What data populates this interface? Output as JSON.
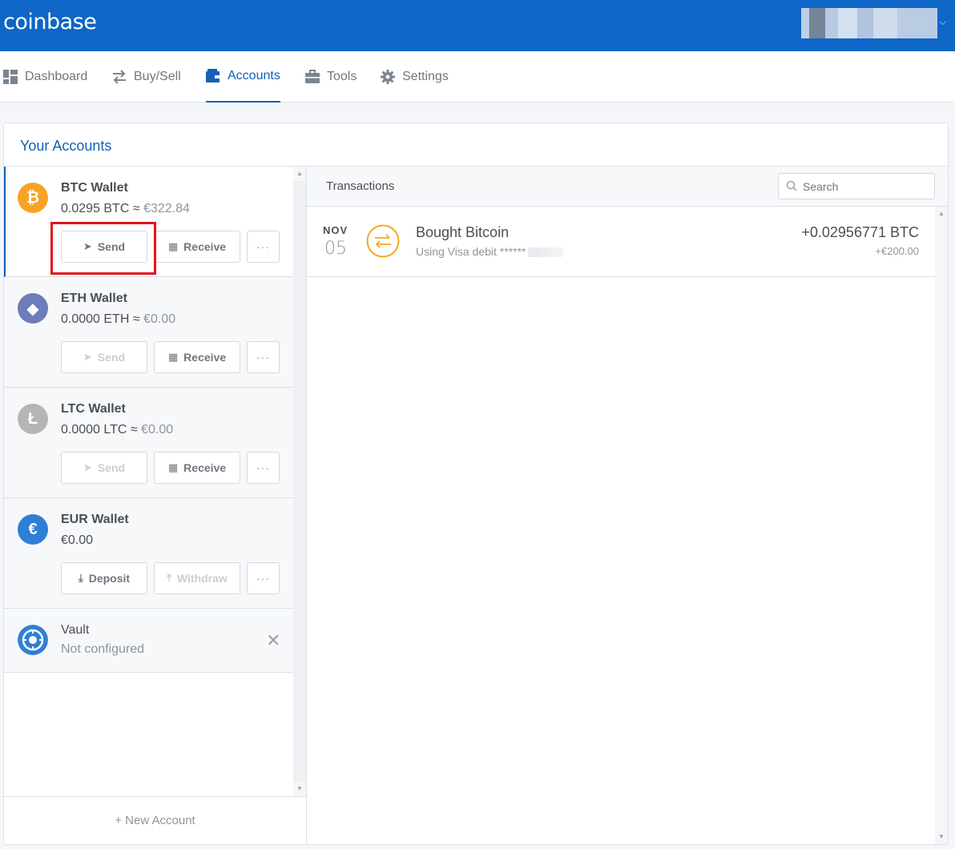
{
  "app": {
    "logo": "coinbase"
  },
  "nav": {
    "items": [
      {
        "label": "Dashboard",
        "icon": "dashboard-grid-icon"
      },
      {
        "label": "Buy/Sell",
        "icon": "swap-arrows-icon"
      },
      {
        "label": "Accounts",
        "icon": "wallet-icon",
        "active": true
      },
      {
        "label": "Tools",
        "icon": "briefcase-icon"
      },
      {
        "label": "Settings",
        "icon": "gear-icon"
      }
    ]
  },
  "accounts": {
    "title": "Your Accounts",
    "wallets": [
      {
        "name": "BTC Wallet",
        "balance": "0.0295 BTC ≈",
        "fiat": "€322.84",
        "color": "#f7a326",
        "symbol": "₿",
        "actions": [
          "Send",
          "Receive",
          "···"
        ],
        "disabled": [
          false,
          false,
          false
        ]
      },
      {
        "name": "ETH Wallet",
        "balance": "0.0000 ETH ≈",
        "fiat": "€0.00",
        "color": "#6f7cba",
        "symbol": "◆",
        "actions": [
          "Send",
          "Receive",
          "···"
        ],
        "disabled": [
          true,
          false,
          false
        ]
      },
      {
        "name": "LTC Wallet",
        "balance": "0.0000 LTC ≈",
        "fiat": "€0.00",
        "color": "#b5b5b5",
        "symbol": "Ł",
        "actions": [
          "Send",
          "Receive",
          "···"
        ],
        "disabled": [
          true,
          false,
          false
        ]
      },
      {
        "name": "EUR Wallet",
        "balance": "€0.00",
        "fiat": "",
        "color": "#2f7fd6",
        "symbol": "€",
        "actions": [
          "Deposit",
          "Withdraw",
          "···"
        ],
        "disabled": [
          false,
          true,
          false
        ]
      }
    ],
    "vault": {
      "name": "Vault",
      "status": "Not configured",
      "color": "#2f7fd6"
    },
    "new_account": "+ New Account"
  },
  "transactions": {
    "title": "Transactions",
    "search_placeholder": "Search",
    "items": [
      {
        "month": "NOV",
        "day": "05",
        "title": "Bought Bitcoin",
        "subtitle": "Using Visa debit ******",
        "amount": "+0.02956771 BTC",
        "fiat": "+€200.00"
      }
    ]
  }
}
